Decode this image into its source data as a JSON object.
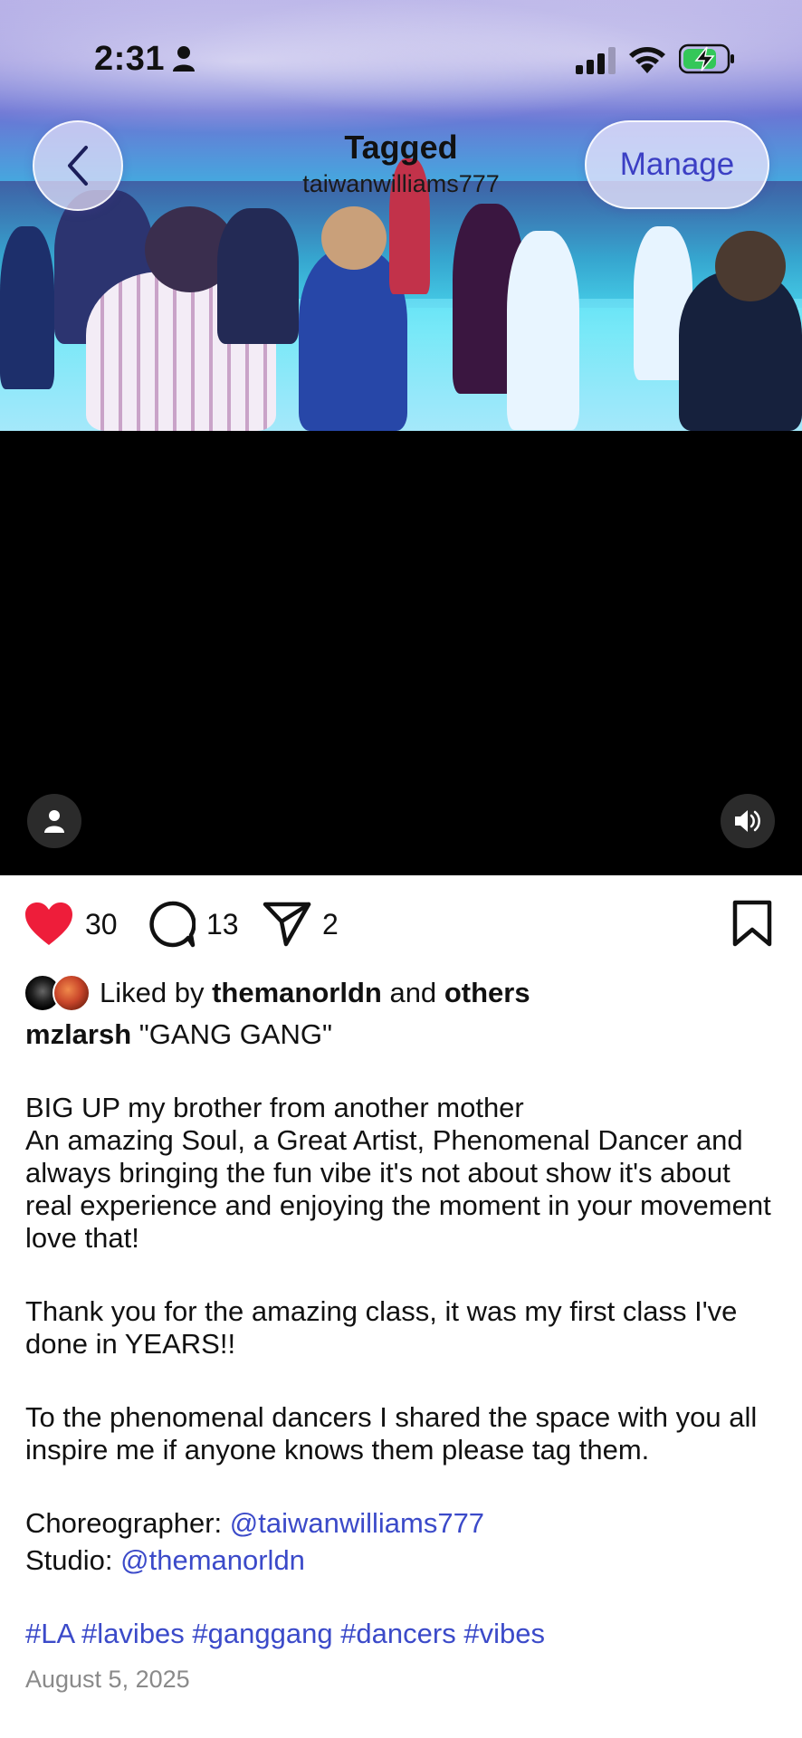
{
  "status_bar": {
    "time": "2:31",
    "icons": [
      "person-icon",
      "cellular-signal-icon",
      "wifi-icon",
      "battery-charging-icon"
    ]
  },
  "header": {
    "title": "Tagged",
    "subtitle": "taiwanwilliams777",
    "manage_label": "Manage",
    "back_icon": "chevron-left-icon"
  },
  "media": {
    "overlay_icons": [
      "person-tag-icon",
      "speaker-icon"
    ]
  },
  "actions": {
    "likes_count": "30",
    "comments_count": "13",
    "shares_count": "2",
    "icons": [
      "heart-icon",
      "comment-icon",
      "send-icon",
      "bookmark-icon"
    ]
  },
  "liked_by": {
    "prefix": "Liked by",
    "user": "themanorldn",
    "connector": "and",
    "others": "others"
  },
  "caption": {
    "username": "mzlarsh",
    "title": " \"GANG GANG\"",
    "line1": "BIG UP my brother from another mother",
    "paragraph1": "An amazing Soul, a Great Artist, Phenomenal Dancer and always bringing the fun vibe it's not about show it's about real experience and enjoying the moment in your movement love that!",
    "paragraph2": "Thank you for the amazing class, it was my first class I've done in YEARS!!",
    "paragraph3": "To the phenomenal dancers I shared the space with you all inspire me if anyone knows them please tag them.",
    "choreographer_label": "Choreographer: ",
    "choreographer_handle": "@taiwanwilliams777",
    "studio_label": "Studio: ",
    "studio_handle": "@themanorldn",
    "hashtags": "#LA #lavibes #ganggang #dancers #vibes"
  },
  "post_date": "August 5, 2025",
  "colors": {
    "like": "#ee1d3a",
    "link": "#3b4ac9",
    "date": "#8a8a8a",
    "manage_text": "#3b3fc4"
  }
}
